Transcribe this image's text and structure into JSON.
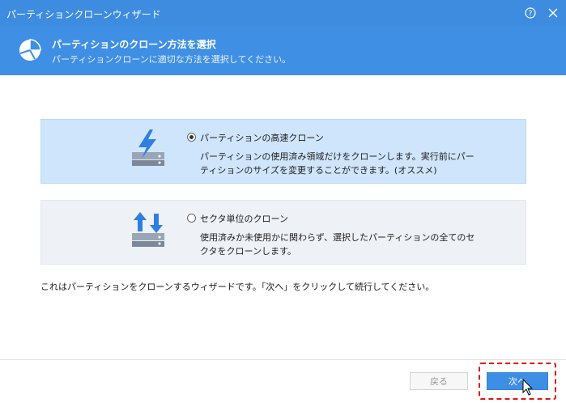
{
  "window": {
    "title": "パーティションクローンウィザード",
    "help_icon": "help-circle-icon",
    "close_icon": "close-icon"
  },
  "header": {
    "title": "パーティションのクローン方法を選択",
    "subtitle": "パーティションクローンに適切な方法を選択してください。",
    "icon": "pie-chart-icon"
  },
  "options": [
    {
      "label": "パーティションの高速クローン",
      "description": "パーティションの使用済み領域だけをクローンします。実行前にパーティションのサイズを変更することができます。(オススメ)",
      "selected": true,
      "icon": "lightning-disk-icon"
    },
    {
      "label": "セクタ単位のクローン",
      "description": "使用済みか未使用かに関わらず、選択したパーティションの全てのセクタをクローンします。",
      "selected": false,
      "icon": "transfer-disk-icon"
    }
  ],
  "note": "これはパーティションをクローンするウィザードです。「次へ」をクリックして続行してください。",
  "buttons": {
    "back": "戻る",
    "next": "次へ"
  },
  "colors": {
    "accent": "#3d8ce0",
    "selected_bg": "#cfe5fb",
    "highlight": "#e01515"
  }
}
